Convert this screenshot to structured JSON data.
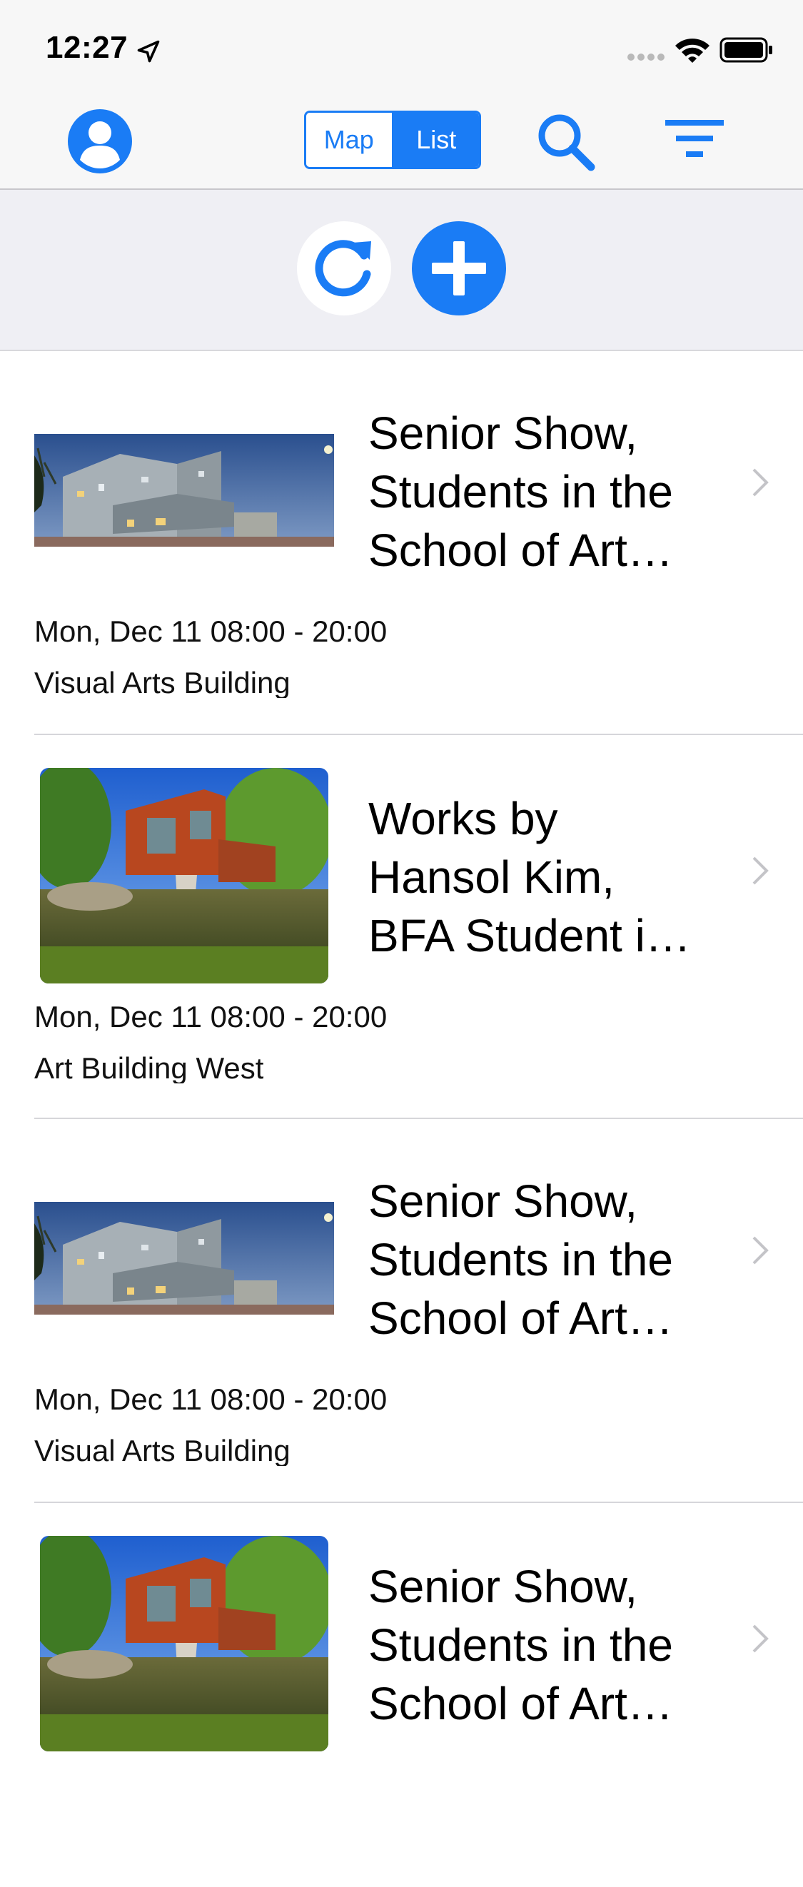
{
  "status_bar": {
    "time": "12:27"
  },
  "nav": {
    "segments": {
      "map": "Map",
      "list": "List"
    },
    "selected_segment": "List"
  },
  "events": [
    {
      "title": "Senior Show, Students in the School of Art and Design",
      "datetime": "Mon, Dec 11 08:00 - 20:00",
      "location": "Visual Arts Building",
      "image": "visual-arts-building"
    },
    {
      "title": "Works by Hansol Kim, BFA Student in the School of Art",
      "datetime": "Mon, Dec 11 08:00 - 20:00",
      "location": "Art Building West",
      "image": "art-building-west"
    },
    {
      "title": "Senior Show, Students in the School of Art and Design",
      "datetime": "Mon, Dec 11 08:00 - 20:00",
      "location": "Visual Arts Building",
      "image": "visual-arts-building"
    },
    {
      "title": "Senior Show, Students in the School of Art and Design",
      "datetime": "",
      "location": "",
      "image": "art-building-west"
    }
  ],
  "colors": {
    "accent": "#1a7cf5",
    "nav_background": "#f7f7f7",
    "action_bar_background": "#efeff4"
  }
}
